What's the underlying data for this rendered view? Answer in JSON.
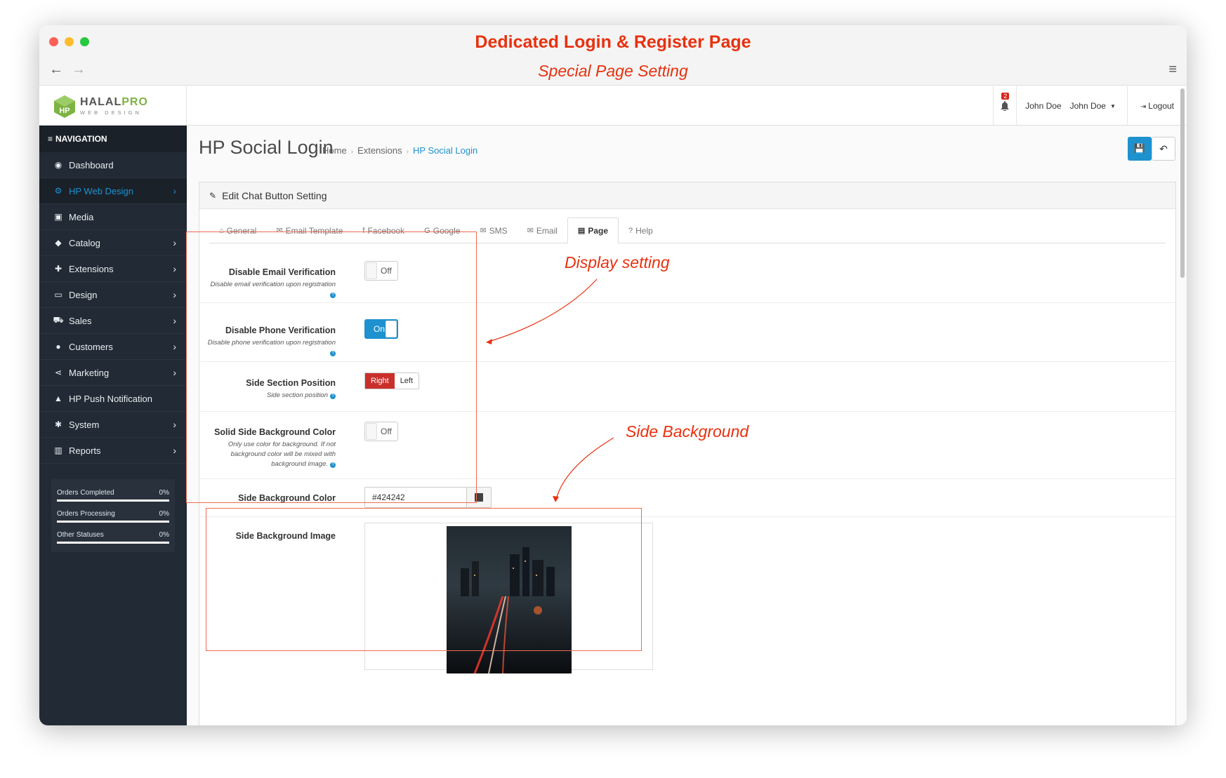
{
  "window": {
    "title": "Dedicated Login & Register Page",
    "subtitle": "Special Page Setting"
  },
  "brand": {
    "name_a": "HALAL",
    "name_b": "PRO",
    "tagline": "WEB DESIGN"
  },
  "header": {
    "notification_count": "2",
    "user_name": "John Doe",
    "user_menu": "John Doe",
    "logout": "Logout"
  },
  "sidebar": {
    "heading": "NAVIGATION",
    "items": [
      {
        "label": "Dashboard",
        "icon": "dashboard-icon"
      },
      {
        "label": "HP Web Design",
        "icon": "cogs-icon"
      },
      {
        "label": "Media",
        "icon": "image-icon"
      },
      {
        "label": "Catalog",
        "icon": "tag-icon"
      },
      {
        "label": "Extensions",
        "icon": "puzzle-icon"
      },
      {
        "label": "Design",
        "icon": "monitor-icon"
      },
      {
        "label": "Sales",
        "icon": "cart-icon"
      },
      {
        "label": "Customers",
        "icon": "user-icon"
      },
      {
        "label": "Marketing",
        "icon": "share-icon"
      },
      {
        "label": "HP Push Notification",
        "icon": "bell-icon"
      },
      {
        "label": "System",
        "icon": "gear-icon"
      },
      {
        "label": "Reports",
        "icon": "bar-chart-icon"
      }
    ],
    "stats": [
      {
        "label": "Orders Completed",
        "value": "0%"
      },
      {
        "label": "Orders Processing",
        "value": "0%"
      },
      {
        "label": "Other Statuses",
        "value": "0%"
      }
    ]
  },
  "page": {
    "title": "HP Social Login",
    "breadcrumb": [
      "Home",
      "Extensions",
      "HP Social Login"
    ]
  },
  "panel": {
    "heading": "Edit Chat Button Setting"
  },
  "tabs": [
    "General",
    "Email Template",
    "Facebook",
    "Google",
    "SMS",
    "Email",
    "Page",
    "Help"
  ],
  "form": {
    "email_verification": {
      "label": "Disable Email Verification",
      "help": "Disable email verification upon registration",
      "state": "Off"
    },
    "phone_verification": {
      "label": "Disable Phone Verification",
      "help": "Disable phone verification upon registration",
      "state": "On"
    },
    "side_position": {
      "label": "Side Section Position",
      "help": "Side section position",
      "options": [
        "Right",
        "Left"
      ],
      "selected": "Right"
    },
    "solid_bg": {
      "label": "Solid Side Background Color",
      "help": "Only use color for background. If not background color will be mixed with background image.",
      "state": "Off"
    },
    "bg_color": {
      "label": "Side Background Color",
      "value": "#424242"
    },
    "bg_image": {
      "label": "Side Background Image"
    }
  },
  "annotations": {
    "display": "Display setting",
    "side_bg": "Side Background"
  },
  "colors": {
    "accent": "#1e91cf",
    "annotation": "#e8310f",
    "sidebar": "#222b35",
    "danger": "#c9302c"
  }
}
